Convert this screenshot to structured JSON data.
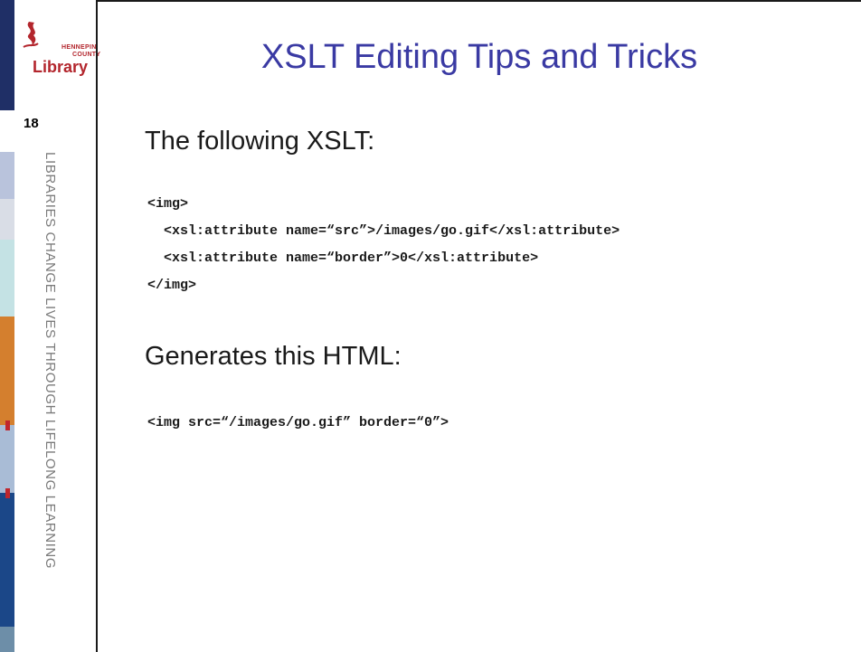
{
  "sidebar": {
    "logo_small_line1": "HENNEPIN",
    "logo_small_line2": "COUNTY",
    "logo_word": "Library",
    "slide_number": "18",
    "tagline": "LIBRARIES CHANGE LIVES THROUGH LIFELONG LEARNING"
  },
  "slide": {
    "title": "XSLT Editing Tips and Tricks",
    "heading1": "The following XSLT:",
    "code1": [
      "<img>",
      "  <xsl:attribute name=“src”>/images/go.gif</xsl:attribute>",
      "  <xsl:attribute name=“border”>0</xsl:attribute>",
      "</img>"
    ],
    "heading2": "Generates this HTML:",
    "code2": [
      "<img src=“/images/go.gif” border=“0”>"
    ]
  },
  "colors": {
    "title": "#3a3aa3",
    "logo": "#b3262d",
    "stripe_navy": "#1f2f66",
    "stripe_orange": "#d47f2e",
    "stripe_blue": "#1b4788"
  }
}
